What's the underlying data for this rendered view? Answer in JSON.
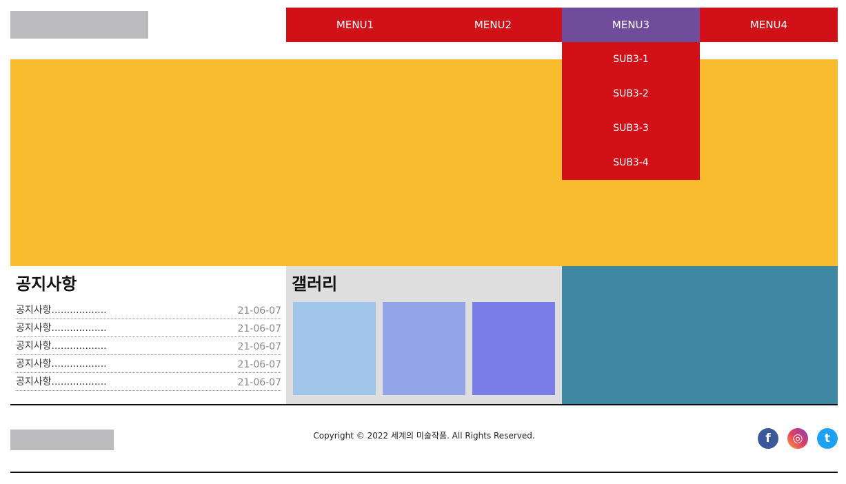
{
  "nav": {
    "items": [
      {
        "label": "MENU1"
      },
      {
        "label": "MENU2"
      },
      {
        "label": "MENU3"
      },
      {
        "label": "MENU4"
      }
    ],
    "active_index": 2,
    "submenu": [
      {
        "label": "SUB3-1"
      },
      {
        "label": "SUB3-2"
      },
      {
        "label": "SUB3-3"
      },
      {
        "label": "SUB3-4"
      }
    ]
  },
  "notice": {
    "title": "공지사항",
    "rows": [
      {
        "text": "공지사항..................",
        "date": "21-06-07"
      },
      {
        "text": "공지사항..................",
        "date": "21-06-07"
      },
      {
        "text": "공지사항..................",
        "date": "21-06-07"
      },
      {
        "text": "공지사항..................",
        "date": "21-06-07"
      },
      {
        "text": "공지사항..................",
        "date": "21-06-07"
      }
    ]
  },
  "gallery": {
    "title": "갤러리",
    "thumb_colors": [
      "#a2c6e9",
      "#93a5e8",
      "#7a7de8"
    ]
  },
  "footer": {
    "copyright": "Copyright © 2022 세계의 미술작품. All Rights Reserved.",
    "social": [
      {
        "icon": "facebook-icon",
        "glyph": "f"
      },
      {
        "icon": "instagram-icon",
        "glyph": "◎"
      },
      {
        "icon": "twitter-icon",
        "glyph": "t"
      }
    ]
  },
  "colors": {
    "nav_red": "#d21018",
    "nav_active": "#704c9c",
    "banner_yellow": "#f9bb2e",
    "gallery_gray": "#dedede",
    "teal_panel": "#3e87a2",
    "placeholder_gray": "#bcbcbe"
  }
}
